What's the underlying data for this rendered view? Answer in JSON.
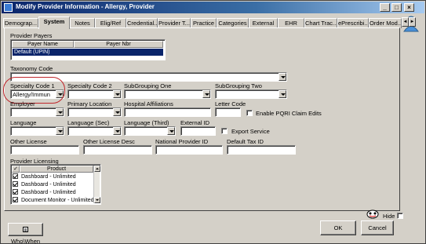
{
  "window": {
    "title": "Modify Provider Information - Allergy, Provider"
  },
  "titlebar_buttons": {
    "minimize": "_",
    "maximize": "□",
    "close": "×"
  },
  "tabs": [
    {
      "label": "Demograp..."
    },
    {
      "label": "System"
    },
    {
      "label": "Notes"
    },
    {
      "label": "Elig/Ref"
    },
    {
      "label": "Credential..."
    },
    {
      "label": "Provider T..."
    },
    {
      "label": "Practice"
    },
    {
      "label": "Categories"
    },
    {
      "label": "External"
    },
    {
      "label": "EHR"
    },
    {
      "label": "Chart Trac..."
    },
    {
      "label": "ePrescribi..."
    },
    {
      "label": "Order Mod..."
    }
  ],
  "tab_scroll": {
    "left": "◄",
    "right": "►"
  },
  "provider_payers": {
    "label": "Provider Payers",
    "columns": [
      "Payer Name",
      "Payer Nbr"
    ],
    "selected_row": "Default (UPIN)"
  },
  "taxonomy": {
    "label": "Taxonomy Code",
    "value": ""
  },
  "specialty1": {
    "label": "Specialty Code 1",
    "value": "Allergy/Immun"
  },
  "specialty2": {
    "label": "Specialty Code 2",
    "value": ""
  },
  "subgroup1": {
    "label": "SubGrouping One",
    "value": ""
  },
  "subgroup2": {
    "label": "SubGrouping Two",
    "value": ""
  },
  "employer": {
    "label": "Employer",
    "value": ""
  },
  "primary_location": {
    "label": "Primary Location",
    "value": ""
  },
  "hospital_affiliations": {
    "label": "Hospital Affiliations",
    "value": ""
  },
  "letter_code": {
    "label": "Letter Code",
    "value": ""
  },
  "pqri": {
    "label": "Enable PQRI Claim Edits"
  },
  "language": {
    "label": "Language",
    "value": ""
  },
  "language_sec": {
    "label": "Language (Sec)",
    "value": ""
  },
  "language_third": {
    "label": "Language (Third)",
    "value": ""
  },
  "external_id": {
    "label": "External ID",
    "value": ""
  },
  "export_service": {
    "label": "Export Service"
  },
  "other_license": {
    "label": "Other License",
    "value": ""
  },
  "other_license_desc": {
    "label": "Other License Desc",
    "value": ""
  },
  "national_provider_id": {
    "label": "National Provider ID",
    "value": ""
  },
  "default_tax_id": {
    "label": "Default Tax ID",
    "value": ""
  },
  "provider_licensing": {
    "label": "Provider Licensing",
    "column": "Product",
    "rows": [
      "Dashboard - Unlimited",
      "Dashboard - Unlimited",
      "Dashboard - Unlimited",
      "Document Monitor - Unlimited"
    ]
  },
  "hide": {
    "label": "Hide"
  },
  "buttons": {
    "who_when": "Who\\When",
    "ok": "OK",
    "cancel": "Cancel"
  },
  "colors": {
    "titlebar": "#0a246a",
    "selection": "#0a246a",
    "highlight_circle": "#c0262b",
    "face": "#d4d0c8"
  }
}
